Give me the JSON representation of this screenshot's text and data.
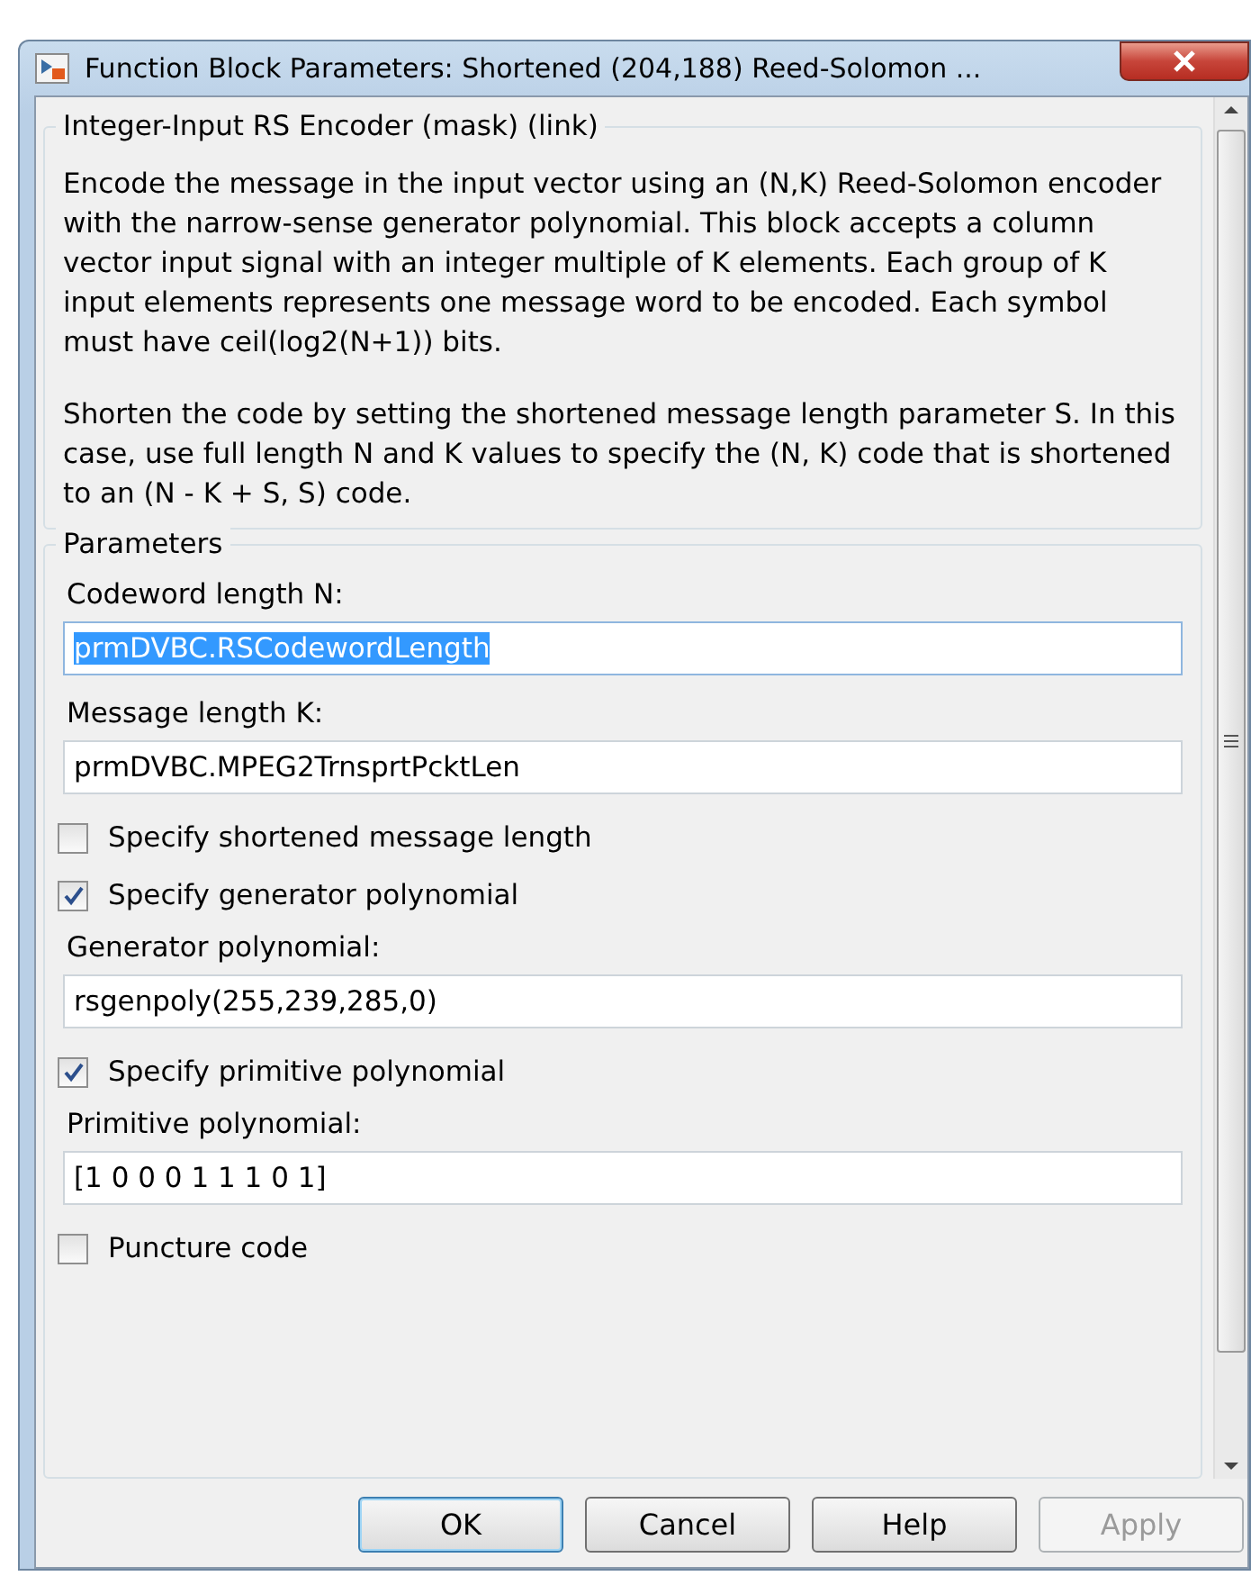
{
  "window": {
    "title": "Function Block Parameters: Shortened (204,188) Reed-Solomon ..."
  },
  "description": {
    "title": "Integer-Input RS Encoder (mask) (link)",
    "paragraphs": [
      "Encode the message in the input vector using an (N,K) Reed-Solomon encoder with the narrow-sense generator polynomial. This block accepts a column vector input signal with an integer multiple of K elements.  Each group of K input elements represents one message word to be encoded.  Each symbol must have ceil(log2(N+1)) bits.",
      "Shorten the code by setting the shortened message length parameter S. In this case, use full length N and K values to specify the (N, K) code that is shortened to an (N - K + S, S) code."
    ]
  },
  "parameters": {
    "title": "Parameters",
    "items": [
      {
        "kind": "field",
        "label": "Codeword length N:",
        "value": "prmDVBC.RSCodewordLength",
        "text_selected": true
      },
      {
        "kind": "field",
        "label": "Message length K:",
        "value": "prmDVBC.MPEG2TrnsprtPcktLen",
        "text_selected": false
      },
      {
        "kind": "checkbox",
        "label": "Specify shortened message length",
        "checked": false
      },
      {
        "kind": "checkbox",
        "label": "Specify generator polynomial",
        "checked": true
      },
      {
        "kind": "field",
        "label": "Generator polynomial:",
        "value": "rsgenpoly(255,239,285,0)",
        "text_selected": false
      },
      {
        "kind": "checkbox",
        "label": "Specify primitive polynomial",
        "checked": true
      },
      {
        "kind": "field",
        "label": "Primitive polynomial:",
        "value": "[1 0 0 0 1 1 1 0 1]",
        "text_selected": false
      },
      {
        "kind": "checkbox",
        "label": "Puncture code",
        "checked": false
      }
    ]
  },
  "buttons": [
    {
      "label": "OK",
      "default": true,
      "disabled": false
    },
    {
      "label": "Cancel",
      "default": false,
      "disabled": false
    },
    {
      "label": "Help",
      "default": false,
      "disabled": false
    },
    {
      "label": "Apply",
      "default": false,
      "disabled": true
    }
  ]
}
